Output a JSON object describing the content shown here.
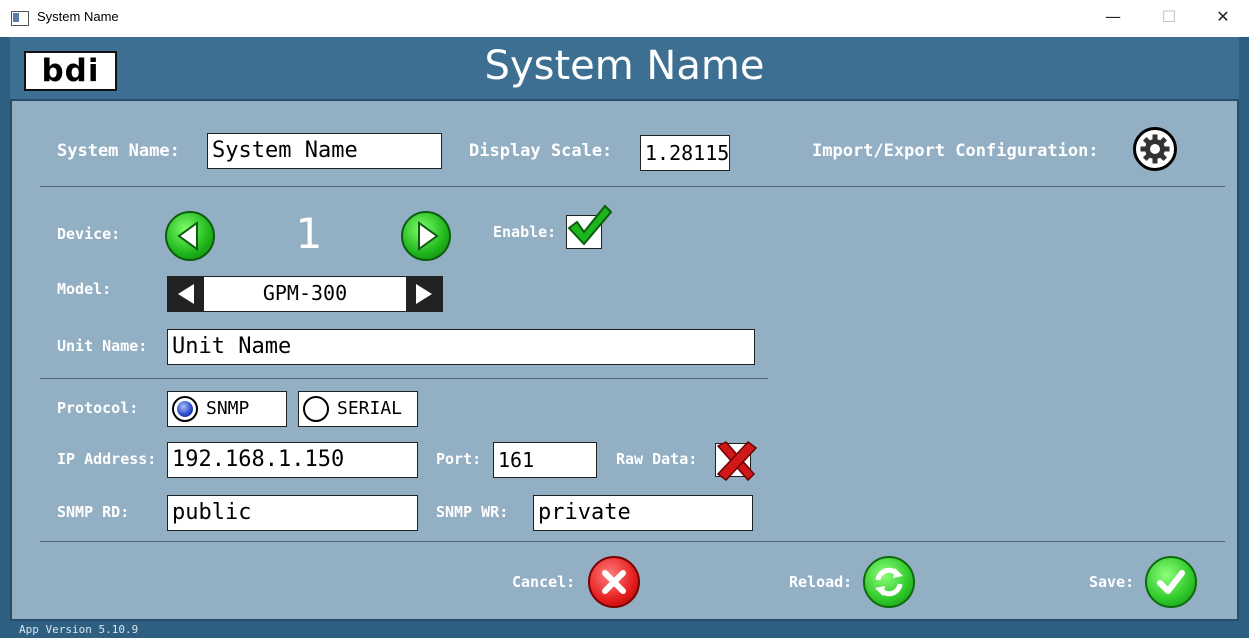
{
  "window": {
    "title": "System Name",
    "minimize": "—",
    "maximize": "☐",
    "close": "✕"
  },
  "header": {
    "logo": "bdi",
    "title": "System Name"
  },
  "system": {
    "name_label": "System Name:",
    "name_value": "System Name",
    "scale_label": "Display Scale:",
    "scale_value": "1.28115",
    "import_label": "Import/Export Configuration:",
    "import_icon": "gear-icon"
  },
  "device": {
    "device_label": "Device:",
    "device_number": "1",
    "enable_label": "Enable:",
    "enabled": true,
    "model_label": "Model:",
    "model_value": "GPM-300",
    "unit_name_label": "Unit Name:",
    "unit_name_value": "Unit Name"
  },
  "protocol": {
    "label": "Protocol:",
    "options": [
      "SNMP",
      "SERIAL"
    ],
    "selected": "SNMP",
    "ip_label": "IP Address:",
    "ip_value": "192.168.1.150",
    "port_label": "Port:",
    "port_value": "161",
    "raw_label": "Raw Data:",
    "raw_enabled": false,
    "snmp_rd_label": "SNMP RD:",
    "snmp_rd_value": "public",
    "snmp_wr_label": "SNMP WR:",
    "snmp_wr_value": "private"
  },
  "actions": {
    "cancel": "Cancel:",
    "reload": "Reload:",
    "save": "Save:"
  },
  "footer": {
    "version": "App Version 5.10.9"
  },
  "colors": {
    "panel": "#93afc4",
    "header": "#3c6f92",
    "frame": "#2e5f80",
    "accent_green": "#1fb51b",
    "accent_red": "#e51d1d"
  }
}
